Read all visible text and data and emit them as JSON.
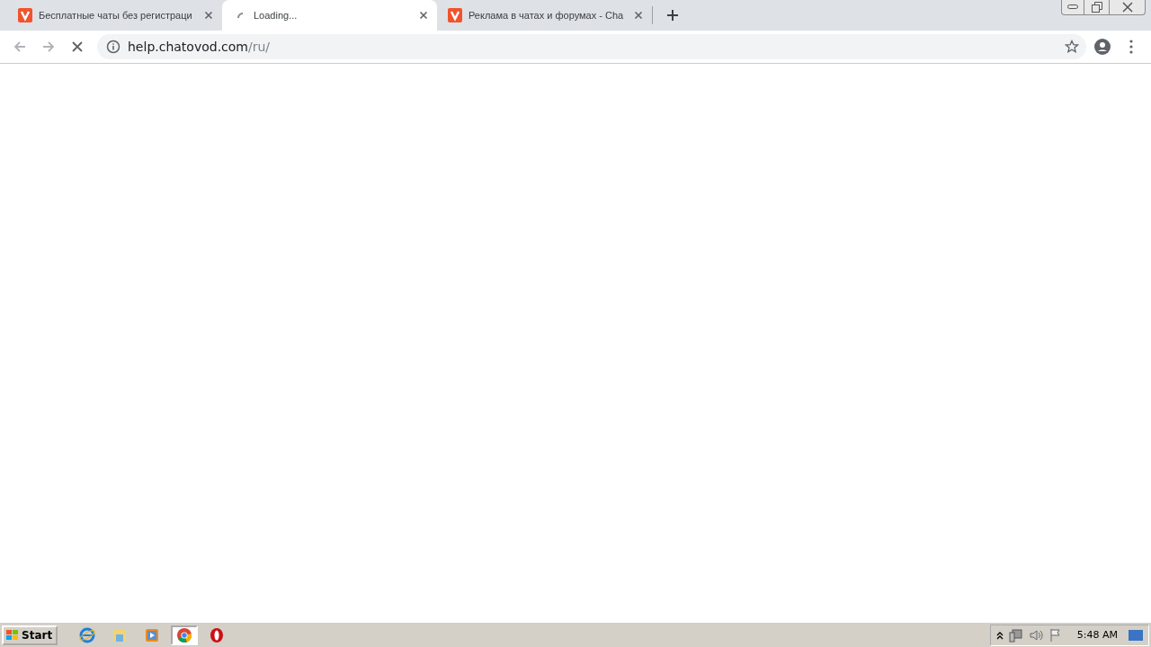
{
  "tabs": [
    {
      "title": "Бесплатные чаты без регистраци",
      "kind": "logo",
      "selected": false
    },
    {
      "title": "Loading...",
      "kind": "spinner",
      "selected": true
    },
    {
      "title": "Реклама в чатах и форумах - Cha",
      "kind": "logo",
      "selected": false
    }
  ],
  "address_bar": {
    "host": "help.chatovod.com",
    "path": "/ru/"
  },
  "taskbar": {
    "start_label": "Start",
    "apps": [
      {
        "kind": "ie",
        "selected": false
      },
      {
        "kind": "folder",
        "selected": false
      },
      {
        "kind": "media",
        "selected": false
      },
      {
        "kind": "chrome",
        "selected": true
      },
      {
        "kind": "opera",
        "selected": false
      }
    ],
    "clock": "5:48 AM"
  }
}
